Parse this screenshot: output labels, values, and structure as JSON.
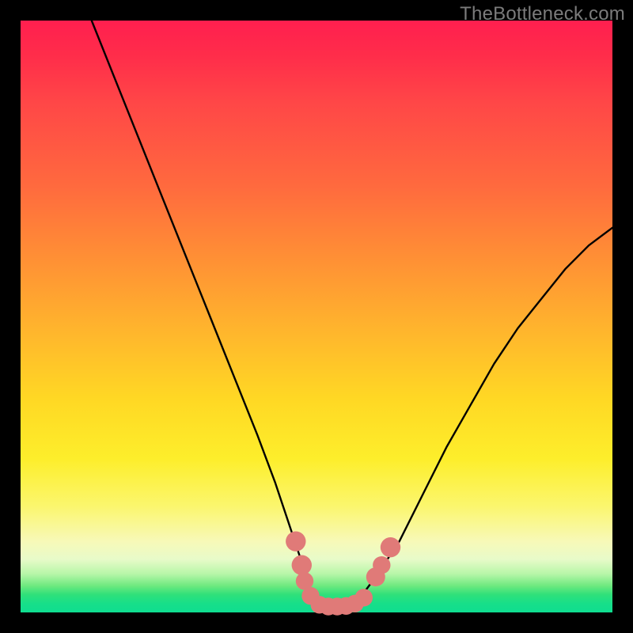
{
  "watermark": "TheBottleneck.com",
  "chart_data": {
    "type": "line",
    "title": "",
    "xlabel": "",
    "ylabel": "",
    "xlim": [
      0,
      100
    ],
    "ylim": [
      0,
      100
    ],
    "series": [
      {
        "name": "bottleneck-curve",
        "x": [
          12,
          16,
          20,
          24,
          28,
          32,
          36,
          40,
          43,
          45,
          47,
          49,
          51,
          53,
          55,
          57,
          60,
          64,
          68,
          72,
          76,
          80,
          84,
          88,
          92,
          96,
          100
        ],
        "values": [
          100,
          90,
          80,
          70,
          60,
          50,
          40,
          30,
          22,
          16,
          10,
          4,
          1,
          1,
          1,
          2,
          6,
          12,
          20,
          28,
          35,
          42,
          48,
          53,
          58,
          62,
          65
        ]
      }
    ],
    "markers": {
      "name": "bottom-dots",
      "color": "#e07a78",
      "points": [
        {
          "x": 46.5,
          "y": 12.0,
          "r": 1.7
        },
        {
          "x": 47.5,
          "y": 8.0,
          "r": 1.7
        },
        {
          "x": 48.0,
          "y": 5.3,
          "r": 1.5
        },
        {
          "x": 49.0,
          "y": 2.8,
          "r": 1.5
        },
        {
          "x": 50.5,
          "y": 1.3,
          "r": 1.5
        },
        {
          "x": 52.0,
          "y": 1.0,
          "r": 1.5
        },
        {
          "x": 53.5,
          "y": 1.0,
          "r": 1.5
        },
        {
          "x": 55.0,
          "y": 1.1,
          "r": 1.5
        },
        {
          "x": 56.5,
          "y": 1.5,
          "r": 1.5
        },
        {
          "x": 58.0,
          "y": 2.5,
          "r": 1.5
        },
        {
          "x": 60.0,
          "y": 6.0,
          "r": 1.6
        },
        {
          "x": 61.0,
          "y": 8.0,
          "r": 1.5
        },
        {
          "x": 62.5,
          "y": 11.0,
          "r": 1.7
        }
      ]
    },
    "gradient_stops": [
      {
        "pos": 0,
        "color": "#ff1f4f"
      },
      {
        "pos": 50,
        "color": "#ffb42d"
      },
      {
        "pos": 80,
        "color": "#fdee2b"
      },
      {
        "pos": 95,
        "color": "#6ee97f"
      },
      {
        "pos": 100,
        "color": "#0fdd90"
      }
    ]
  }
}
